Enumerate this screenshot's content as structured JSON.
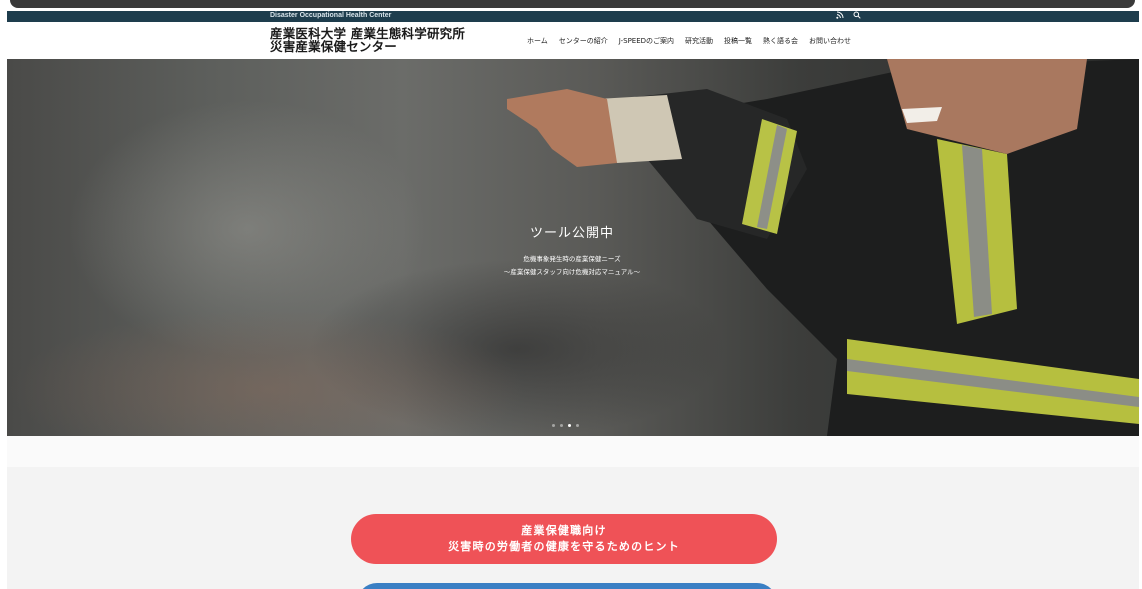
{
  "topbar": {
    "tagline": "Disaster Occupational Health Center",
    "rss_icon": "rss-icon",
    "search_icon": "search-icon"
  },
  "header": {
    "logo_line1": "産業医科大学 産業生態科学研究所",
    "logo_line2": "災害産業保健センター",
    "nav": [
      "ホーム",
      "センターの紹介",
      "J-SPEEDのご案内",
      "研究活動",
      "投稿一覧",
      "熱く語る会",
      "お問い合わせ"
    ]
  },
  "hero": {
    "title": "ツール公開中",
    "subtitle1": "危機事象発生時の産業保健ニーズ",
    "subtitle2": "〜産業保健スタッフ向け危機対応マニュアル〜",
    "slides_total": 4,
    "slide_active": 3
  },
  "cta": {
    "red_line1": "産業保健職向け",
    "red_line2": "災害時の労働者の健康を守るためのヒント",
    "red_color": "#ef5257",
    "blue_color": "#3a7fc4"
  }
}
